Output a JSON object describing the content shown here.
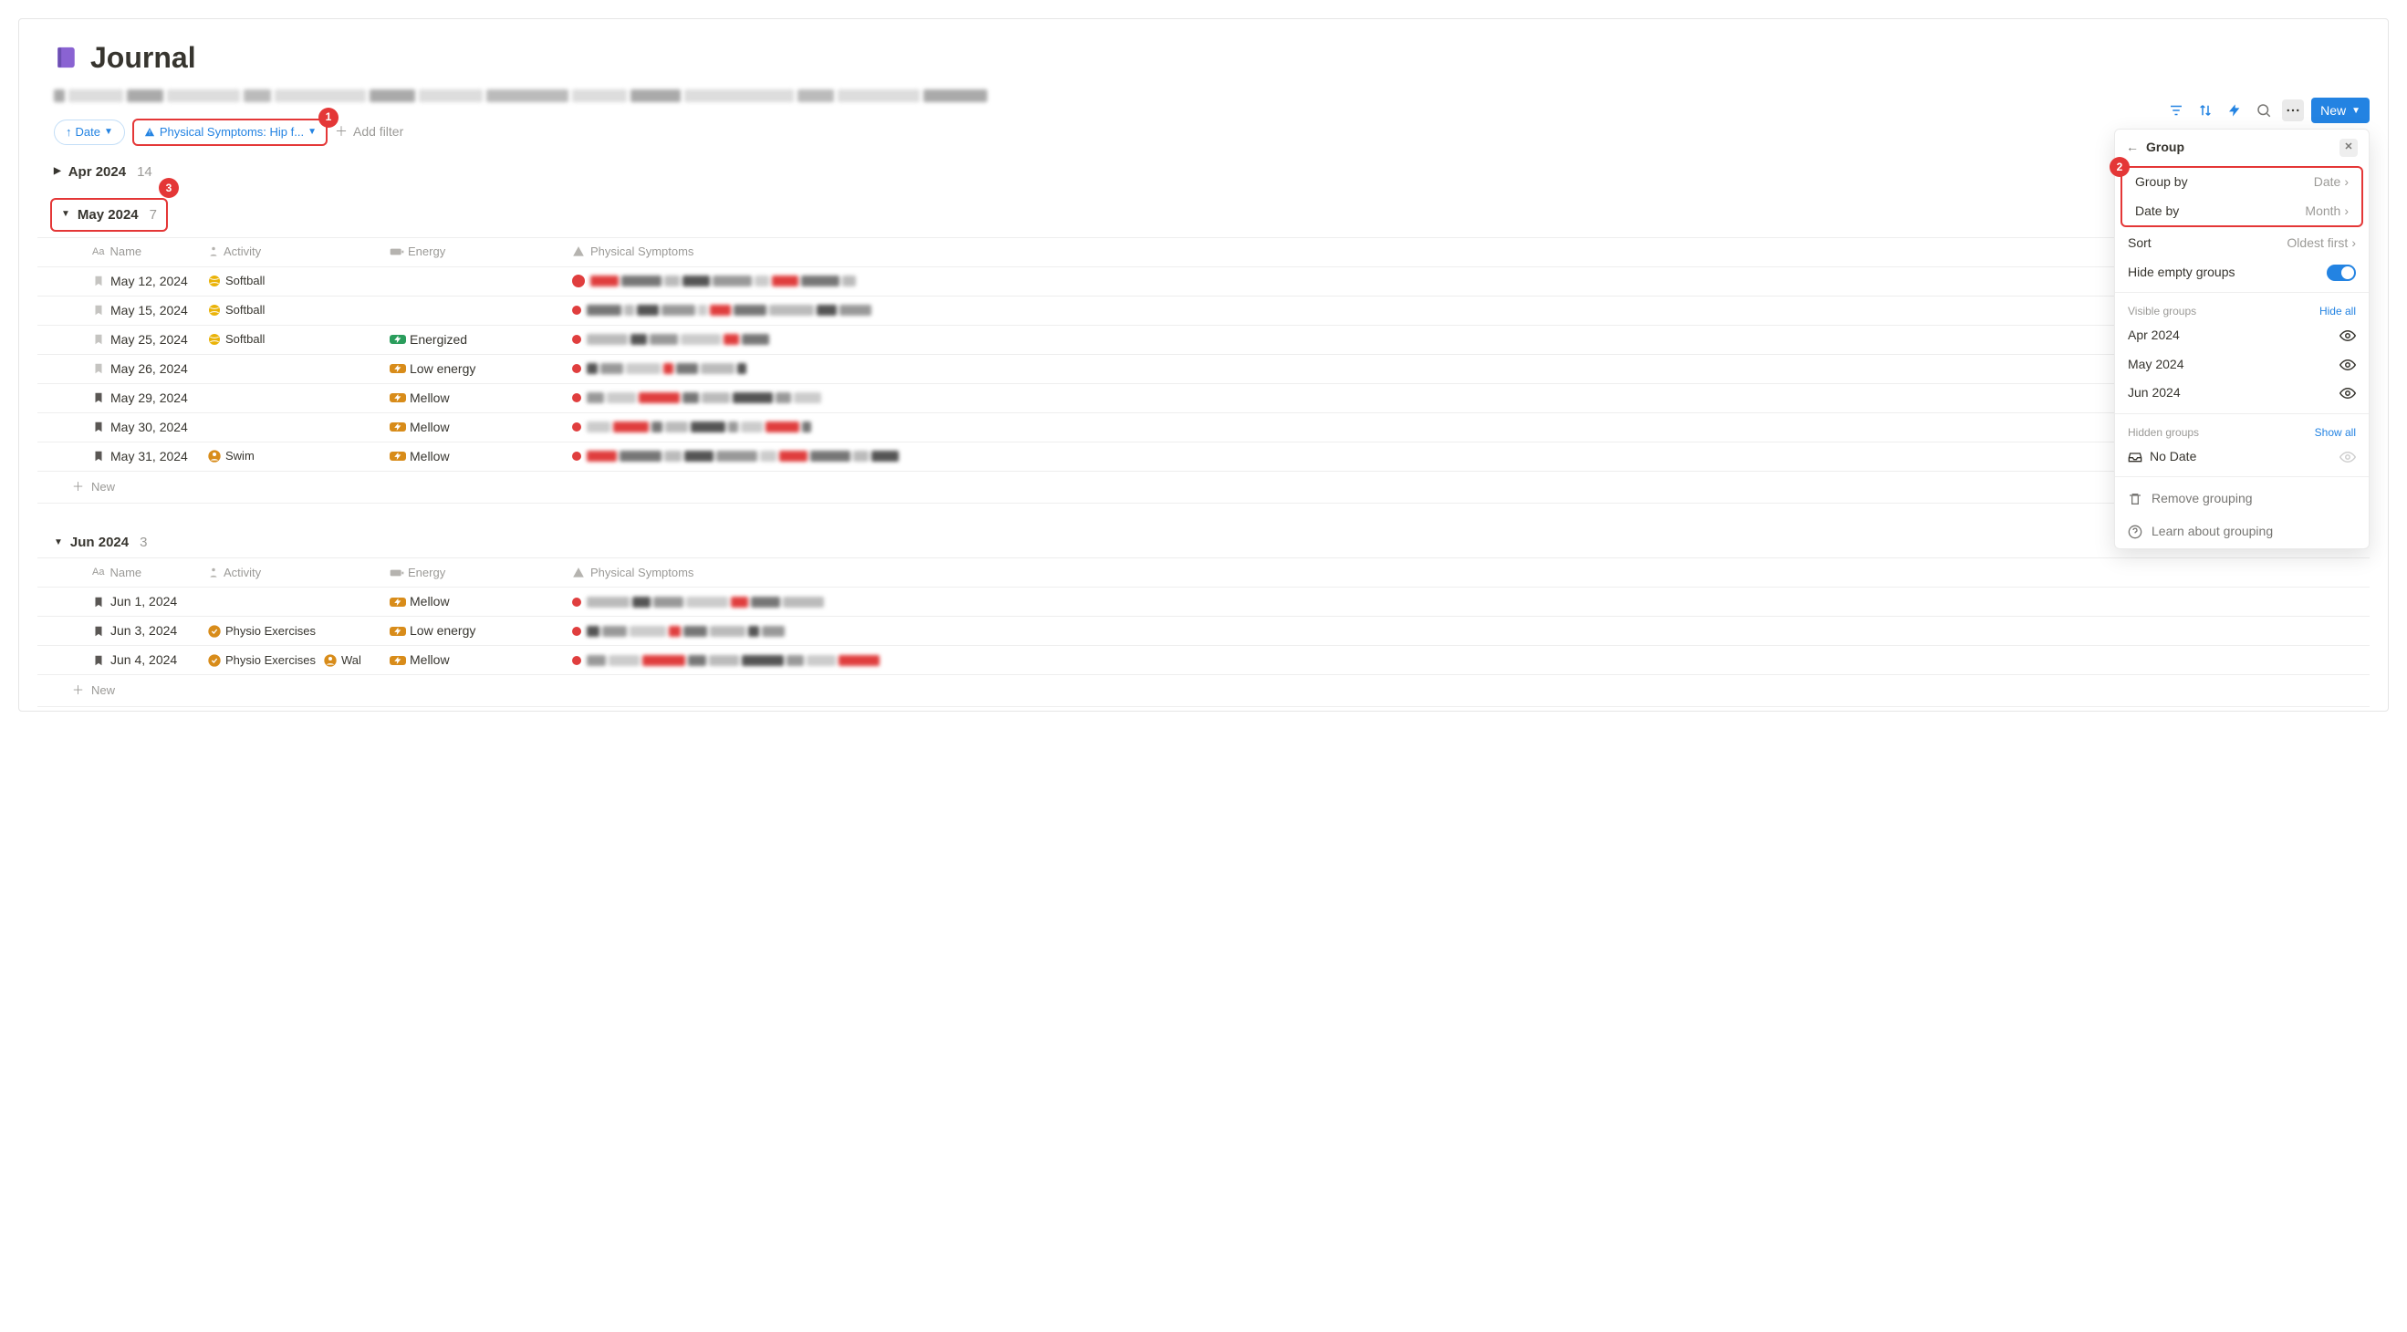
{
  "page": {
    "title": "Journal"
  },
  "toolbar": {
    "new_label": "New"
  },
  "filters": {
    "sort_chip_label": "Date",
    "filter_chip_label": "Physical Symptoms: Hip f...",
    "add_filter_label": "Add filter"
  },
  "annotations": {
    "one": "1",
    "two": "2",
    "three": "3"
  },
  "columns": {
    "name": "Name",
    "activity": "Activity",
    "energy": "Energy",
    "symptoms": "Physical Symptoms"
  },
  "groups": {
    "apr": {
      "label": "Apr 2024",
      "count": "14"
    },
    "may": {
      "label": "May 2024",
      "count": "7",
      "rows": [
        {
          "date": "May 12, 2024",
          "activity": "Softball",
          "activity_icon": "ball",
          "energy": "",
          "bookmark": false
        },
        {
          "date": "May 15, 2024",
          "activity": "Softball",
          "activity_icon": "ball",
          "energy": "",
          "bookmark": false
        },
        {
          "date": "May 25, 2024",
          "activity": "Softball",
          "activity_icon": "ball",
          "energy": "Energized",
          "energy_color": "green",
          "bookmark": false
        },
        {
          "date": "May 26, 2024",
          "activity": "",
          "activity_icon": "",
          "energy": "Low energy",
          "energy_color": "orange",
          "bookmark": false
        },
        {
          "date": "May 29, 2024",
          "activity": "",
          "activity_icon": "",
          "energy": "Mellow",
          "energy_color": "orange",
          "bookmark": true
        },
        {
          "date": "May 30, 2024",
          "activity": "",
          "activity_icon": "",
          "energy": "Mellow",
          "energy_color": "orange",
          "bookmark": true
        },
        {
          "date": "May 31, 2024",
          "activity": "Swim",
          "activity_icon": "person",
          "energy": "Mellow",
          "energy_color": "orange",
          "bookmark": true
        }
      ]
    },
    "jun": {
      "label": "Jun 2024",
      "count": "3",
      "rows": [
        {
          "date": "Jun 1, 2024",
          "activity": "",
          "activity_icon": "",
          "energy": "Mellow",
          "energy_color": "orange",
          "bookmark": true
        },
        {
          "date": "Jun 3, 2024",
          "activity": "Physio Exercises",
          "activity_icon": "physio",
          "energy": "Low energy",
          "energy_color": "orange",
          "bookmark": true
        },
        {
          "date": "Jun 4, 2024",
          "activity": "Physio Exercises",
          "activity_icon": "physio",
          "activity2": "Wal",
          "activity2_icon": "person",
          "energy": "Mellow",
          "energy_color": "orange",
          "bookmark": true
        }
      ]
    }
  },
  "new_row_label": "New",
  "popover": {
    "title": "Group",
    "group_by_label": "Group by",
    "group_by_value": "Date",
    "date_by_label": "Date by",
    "date_by_value": "Month",
    "sort_label": "Sort",
    "sort_value": "Oldest first",
    "hide_empty_label": "Hide empty groups",
    "visible_groups_label": "Visible groups",
    "hide_all_label": "Hide all",
    "visible_groups": [
      "Apr 2024",
      "May 2024",
      "Jun 2024"
    ],
    "hidden_groups_label": "Hidden groups",
    "show_all_label": "Show all",
    "no_date_label": "No Date",
    "remove_label": "Remove grouping",
    "learn_label": "Learn about grouping"
  }
}
